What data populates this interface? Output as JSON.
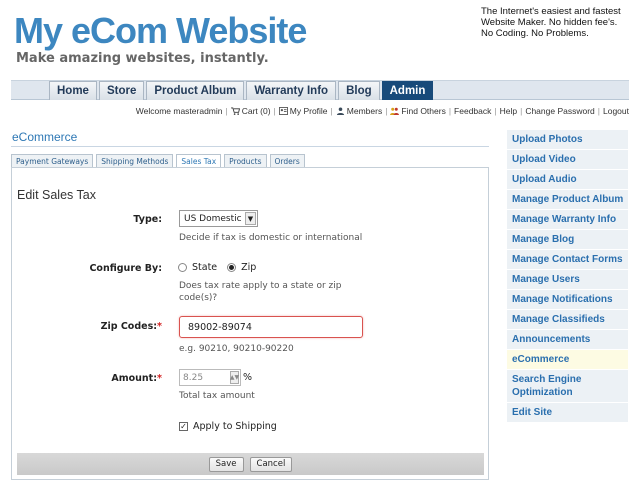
{
  "site": {
    "logo": "My eCom Website",
    "tagline": "Make amazing websites, instantly.",
    "blurb": "The Internet's easiest and fastest Website Maker. No hidden fee's. No Coding. No Problems."
  },
  "nav": {
    "tabs": [
      "Home",
      "Store",
      "Product Album",
      "Warranty Info",
      "Blog",
      "Admin"
    ],
    "active": "Admin"
  },
  "userbar": {
    "welcome": "Welcome masteradmin",
    "cart": "Cart (0)",
    "profile": "My Profile",
    "members": "Members",
    "find_others": "Find Others",
    "feedback": "Feedback",
    "help": "Help",
    "change_password": "Change Password",
    "logout": "Logout"
  },
  "section": {
    "title": "eCommerce",
    "subtabs": [
      "Payment Gateways",
      "Shipping Methods",
      "Sales Tax",
      "Products",
      "Orders"
    ],
    "active_subtab": "Sales Tax"
  },
  "form": {
    "title": "Edit Sales Tax",
    "type_label": "Type:",
    "type_value": "US Domestic",
    "type_hint": "Decide if tax is domestic or international",
    "configure_label": "Configure By:",
    "option_state": "State",
    "option_zip": "Zip",
    "configure_selected": "Zip",
    "configure_hint": "Does tax rate apply to a state or zip code(s)?",
    "zip_label": "Zip Codes:",
    "zip_value": "89002-89074",
    "zip_hint": "e.g. 90210, 90210-90220",
    "amount_label": "Amount:",
    "amount_placeholder": "8.25",
    "amount_unit": "%",
    "amount_hint": "Total tax amount",
    "required_mark": "*",
    "apply_shipping_label": "Apply to Shipping",
    "apply_shipping_checked": true,
    "save_label": "Save",
    "cancel_label": "Cancel"
  },
  "sidebar": {
    "items": [
      "Upload Photos",
      "Upload Video",
      "Upload Audio",
      "Manage Product Album",
      "Manage Warranty Info",
      "Manage Blog",
      "Manage Contact Forms",
      "Manage Users",
      "Manage Notifications",
      "Manage Classifieds",
      "Announcements",
      "eCommerce",
      "Search Engine Optimization",
      "Edit Site"
    ],
    "active": "eCommerce"
  },
  "colors": {
    "brand": "#3d87c0",
    "nav_active": "#174a7a",
    "link": "#2a6fae",
    "required": "#d21f1f"
  }
}
